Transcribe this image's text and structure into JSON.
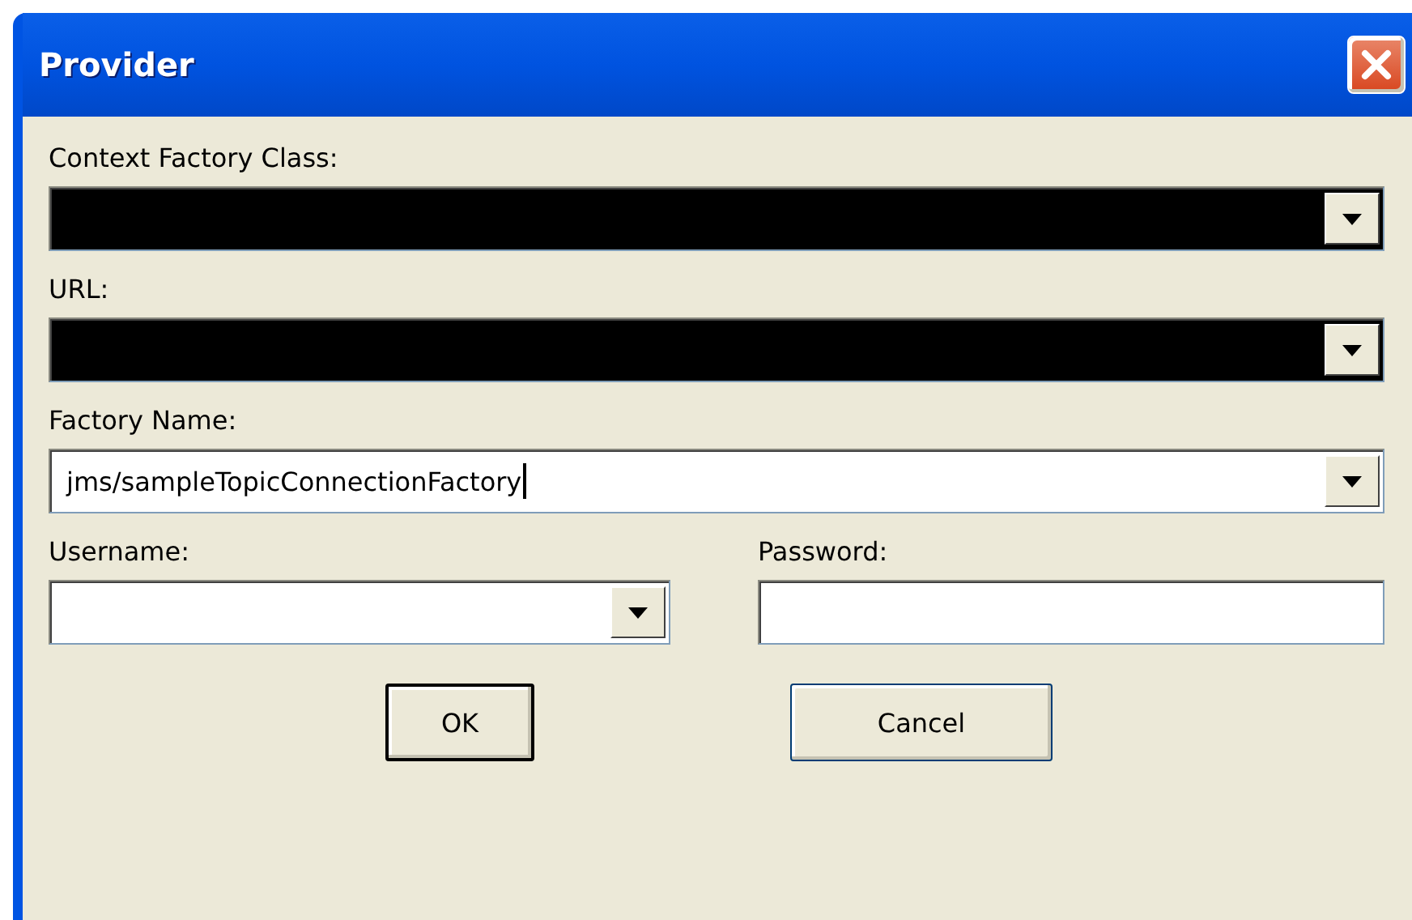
{
  "window": {
    "title": "Provider"
  },
  "fields": [
    {
      "kind": "combo",
      "label": "Context Factory Class:",
      "blacked_out": true
    },
    {
      "kind": "combo",
      "label": "URL:",
      "blacked_out": true
    },
    {
      "kind": "combo",
      "label": "Factory Name:",
      "value": "jms/sampleTopicConnectionFactory",
      "focused": true
    }
  ],
  "credentials": [
    {
      "kind": "combo",
      "label": "Username:"
    },
    {
      "kind": "text",
      "label": "Password:"
    }
  ],
  "buttons": [
    {
      "label": "OK",
      "default": true
    },
    {
      "label": "Cancel",
      "default": false
    }
  ]
}
